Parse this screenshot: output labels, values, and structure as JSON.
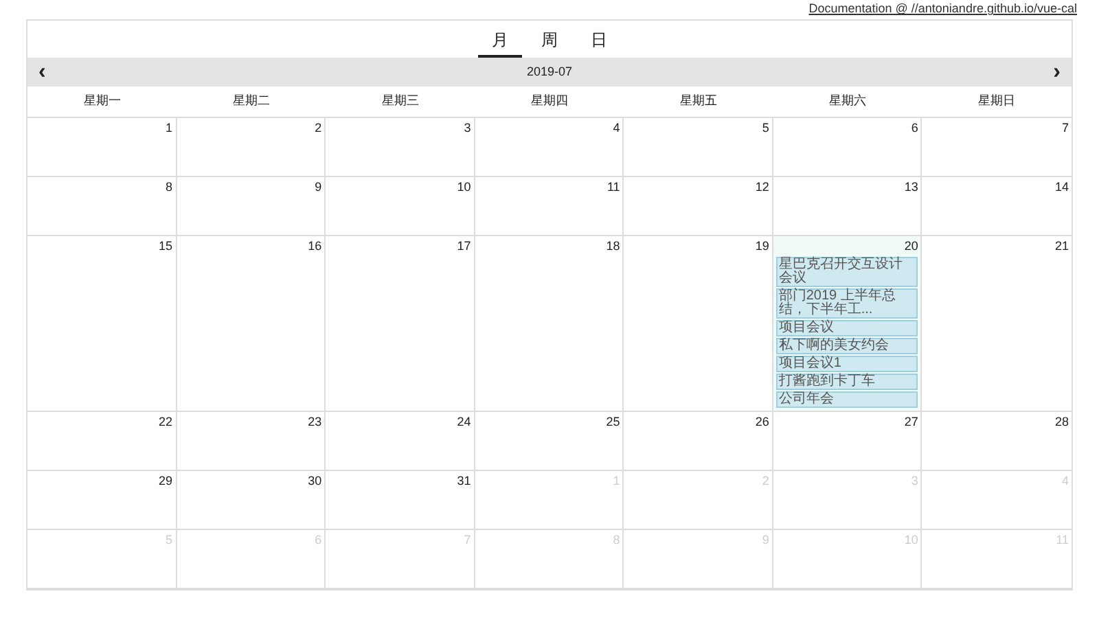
{
  "doc_link": "Documentation @ //antoniandre.github.io/vue-cal",
  "views": [
    {
      "label": "月",
      "selected": true
    },
    {
      "label": "周",
      "selected": false
    },
    {
      "label": "日",
      "selected": false
    }
  ],
  "nav": {
    "prev": "‹",
    "title": "2019-07",
    "next": "›"
  },
  "weekdays": [
    "星期一",
    "星期二",
    "星期三",
    "星期四",
    "星期五",
    "星期六",
    "星期日"
  ],
  "weeks": [
    [
      {
        "day": "1",
        "out": false,
        "selected": false
      },
      {
        "day": "2",
        "out": false,
        "selected": false
      },
      {
        "day": "3",
        "out": false,
        "selected": false
      },
      {
        "day": "4",
        "out": false,
        "selected": false
      },
      {
        "day": "5",
        "out": false,
        "selected": false
      },
      {
        "day": "6",
        "out": false,
        "selected": false
      },
      {
        "day": "7",
        "out": false,
        "selected": false
      }
    ],
    [
      {
        "day": "8",
        "out": false,
        "selected": false
      },
      {
        "day": "9",
        "out": false,
        "selected": false
      },
      {
        "day": "10",
        "out": false,
        "selected": false
      },
      {
        "day": "11",
        "out": false,
        "selected": false
      },
      {
        "day": "12",
        "out": false,
        "selected": false
      },
      {
        "day": "13",
        "out": false,
        "selected": false
      },
      {
        "day": "14",
        "out": false,
        "selected": false
      }
    ],
    [
      {
        "day": "15",
        "out": false,
        "selected": false
      },
      {
        "day": "16",
        "out": false,
        "selected": false
      },
      {
        "day": "17",
        "out": false,
        "selected": false
      },
      {
        "day": "18",
        "out": false,
        "selected": false
      },
      {
        "day": "19",
        "out": false,
        "selected": false
      },
      {
        "day": "20",
        "out": false,
        "selected": true,
        "events": [
          "星巴克召开交互设计会议",
          "部门2019 上半年总结，下半年工...",
          "项目会议",
          "私下啊的美女约会",
          "项目会议1",
          "打酱跑到卡丁车",
          "公司年会"
        ]
      },
      {
        "day": "21",
        "out": false,
        "selected": false
      }
    ],
    [
      {
        "day": "22",
        "out": false,
        "selected": false
      },
      {
        "day": "23",
        "out": false,
        "selected": false
      },
      {
        "day": "24",
        "out": false,
        "selected": false
      },
      {
        "day": "25",
        "out": false,
        "selected": false
      },
      {
        "day": "26",
        "out": false,
        "selected": false
      },
      {
        "day": "27",
        "out": false,
        "selected": false
      },
      {
        "day": "28",
        "out": false,
        "selected": false
      }
    ],
    [
      {
        "day": "29",
        "out": false,
        "selected": false
      },
      {
        "day": "30",
        "out": false,
        "selected": false
      },
      {
        "day": "31",
        "out": false,
        "selected": false
      },
      {
        "day": "1",
        "out": true,
        "selected": false
      },
      {
        "day": "2",
        "out": true,
        "selected": false
      },
      {
        "day": "3",
        "out": true,
        "selected": false
      },
      {
        "day": "4",
        "out": true,
        "selected": false
      }
    ],
    [
      {
        "day": "5",
        "out": true,
        "selected": false
      },
      {
        "day": "6",
        "out": true,
        "selected": false
      },
      {
        "day": "7",
        "out": true,
        "selected": false
      },
      {
        "day": "8",
        "out": true,
        "selected": false
      },
      {
        "day": "9",
        "out": true,
        "selected": false
      },
      {
        "day": "10",
        "out": true,
        "selected": false
      },
      {
        "day": "11",
        "out": true,
        "selected": false
      }
    ]
  ]
}
